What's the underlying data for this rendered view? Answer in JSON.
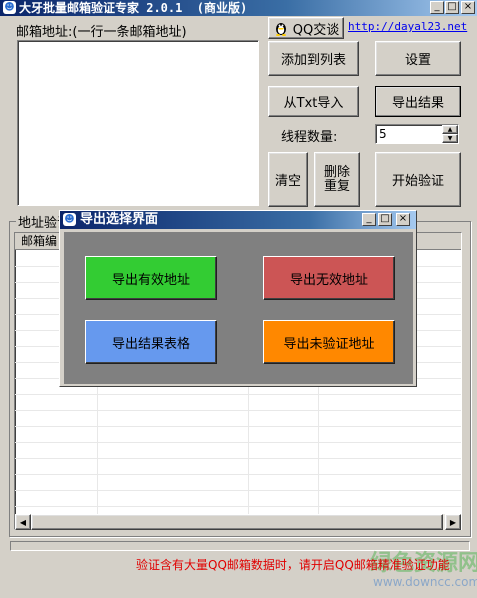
{
  "window": {
    "title": "大牙批量邮箱验证专家 2.0.1  (商业版)",
    "minimize": "_",
    "maximize": "□",
    "close": "×"
  },
  "header": {
    "email_label": "邮箱地址:(一行一条邮箱地址)",
    "qq_button": "QQ交谈",
    "link": "http://dayal23.net"
  },
  "toolbar": {
    "add_to_list": "添加到列表",
    "settings": "设置",
    "import_txt": "从Txt导入",
    "export_results": "导出结果",
    "thread_label": "线程数量:",
    "thread_value": "5",
    "clear": "清空",
    "dedupe_line1": "删除",
    "dedupe_line2": "重复",
    "start": "开始验证"
  },
  "results": {
    "group_label": "地址验证",
    "columns": [
      "邮箱编",
      "",
      "",
      ""
    ]
  },
  "footer": {
    "warning": "验证含有大量QQ邮箱数据时，请开启QQ邮箱精准验证功能",
    "watermark": "绿色资源网",
    "watermark_url": "www.downcc.com"
  },
  "dialog": {
    "title": "导出选择界面",
    "export_valid": "导出有效地址",
    "export_invalid": "导出无效地址",
    "export_table": "导出结果表格",
    "export_unverified": "导出未验证地址"
  },
  "colors": {
    "valid": "#33cc33",
    "invalid": "#cc5555",
    "table": "#6699ee",
    "unverified": "#ff8800"
  }
}
